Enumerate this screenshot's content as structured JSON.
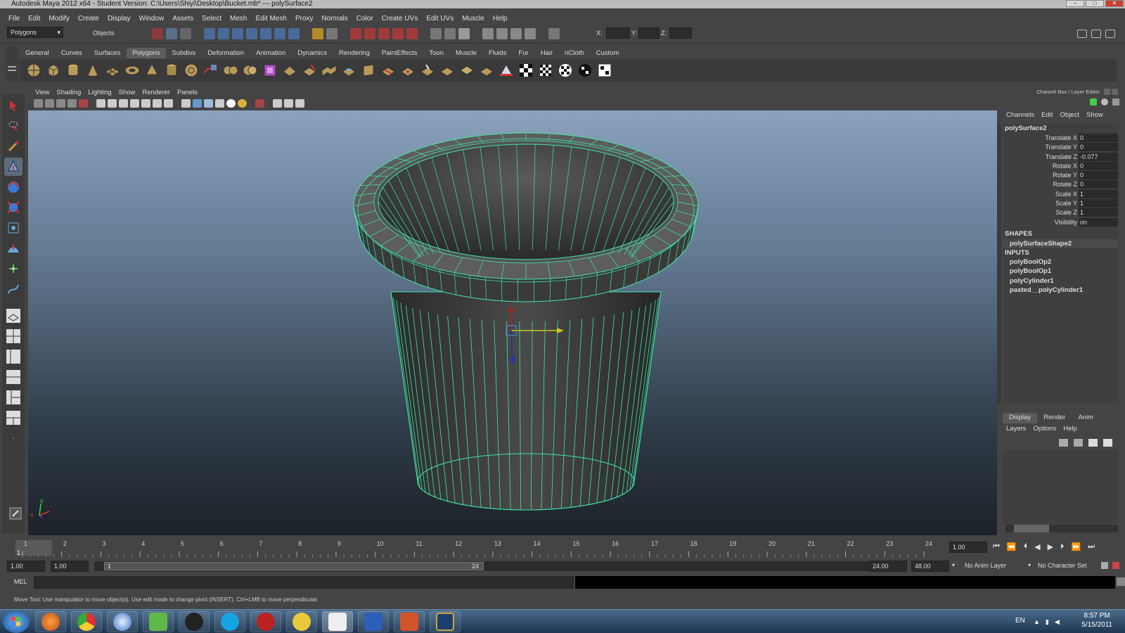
{
  "window": {
    "title": "Autodesk Maya 2012 x64 - Student Version: C:\\Users\\Shiyi\\Desktop\\Bucket.mb*   ---   polySurface2",
    "controls": [
      "–",
      "□",
      "✕"
    ]
  },
  "menubar": [
    "File",
    "Edit",
    "Modify",
    "Create",
    "Display",
    "Window",
    "Assets",
    "Select",
    "Mesh",
    "Edit Mesh",
    "Proxy",
    "Normals",
    "Color",
    "Create UVs",
    "Edit UVs",
    "Muscle",
    "Help"
  ],
  "statusline": {
    "menu_set": "Polygons",
    "objects_label": "Objects",
    "x_label": "X:",
    "y_label": "Y:",
    "z_label": "Z:"
  },
  "shelf": {
    "tabs": [
      "General",
      "Curves",
      "Surfaces",
      "Polygons",
      "Subdivs",
      "Deformation",
      "Animation",
      "Dynamics",
      "Rendering",
      "PaintEffects",
      "Toon",
      "Muscle",
      "Fluids",
      "Fur",
      "Hair",
      "nCloth",
      "Custom"
    ],
    "active_tab": "Polygons"
  },
  "panel": {
    "menus": [
      "View",
      "Shading",
      "Lighting",
      "Show",
      "Renderer",
      "Panels"
    ],
    "axis_x": "x",
    "axis_y": "y"
  },
  "channel_box": {
    "header": "Channel Box / Layer Editor",
    "menus": [
      "Channels",
      "Edit",
      "Object",
      "Show"
    ],
    "object_name": "polySurface2",
    "attributes": [
      {
        "label": "Translate X",
        "value": "0"
      },
      {
        "label": "Translate Y",
        "value": "0"
      },
      {
        "label": "Translate Z",
        "value": "-0.077"
      },
      {
        "label": "Rotate X",
        "value": "0"
      },
      {
        "label": "Rotate Y",
        "value": "0"
      },
      {
        "label": "Rotate Z",
        "value": "0"
      },
      {
        "label": "Scale X",
        "value": "1"
      },
      {
        "label": "Scale Y",
        "value": "1"
      },
      {
        "label": "Scale Z",
        "value": "1"
      },
      {
        "label": "Visibility",
        "value": "on"
      }
    ],
    "shapes_label": "SHAPES",
    "shape": "polySurfaceShape2",
    "inputs_label": "INPUTS",
    "inputs": [
      "polyBoolOp2",
      "polyBoolOp1",
      "polyCylinder1",
      "pasted__polyCylinder1"
    ]
  },
  "layer_editor": {
    "tabs": [
      "Display",
      "Render",
      "Anim"
    ],
    "active_tab": "Display",
    "menus": [
      "Layers",
      "Options",
      "Help"
    ]
  },
  "timeline": {
    "ticks": [
      "1",
      "2",
      "3",
      "4",
      "5",
      "6",
      "7",
      "8",
      "9",
      "10",
      "11",
      "12",
      "13",
      "14",
      "15",
      "16",
      "17",
      "18",
      "19",
      "20",
      "21",
      "22",
      "23",
      "24"
    ],
    "current_frame_marker": "1",
    "current_time": "1.00"
  },
  "range": {
    "start_time": "1.00",
    "playback_start": "1.00",
    "range_start": "1",
    "range_end": "24",
    "playback_end": "24.00",
    "end_time": "48.00",
    "anim_layer": "No Anim Layer",
    "character_set": "No Character Set"
  },
  "command_line": {
    "label": "MEL"
  },
  "help_line": "Move Tool: Use manipulator to move object(s). Use edit mode to change pivot (INSERT).  Ctrl+LMB to move perpendicular.",
  "taskbar": {
    "language": "EN",
    "time": "8:57 PM",
    "date": "5/15/2011"
  }
}
